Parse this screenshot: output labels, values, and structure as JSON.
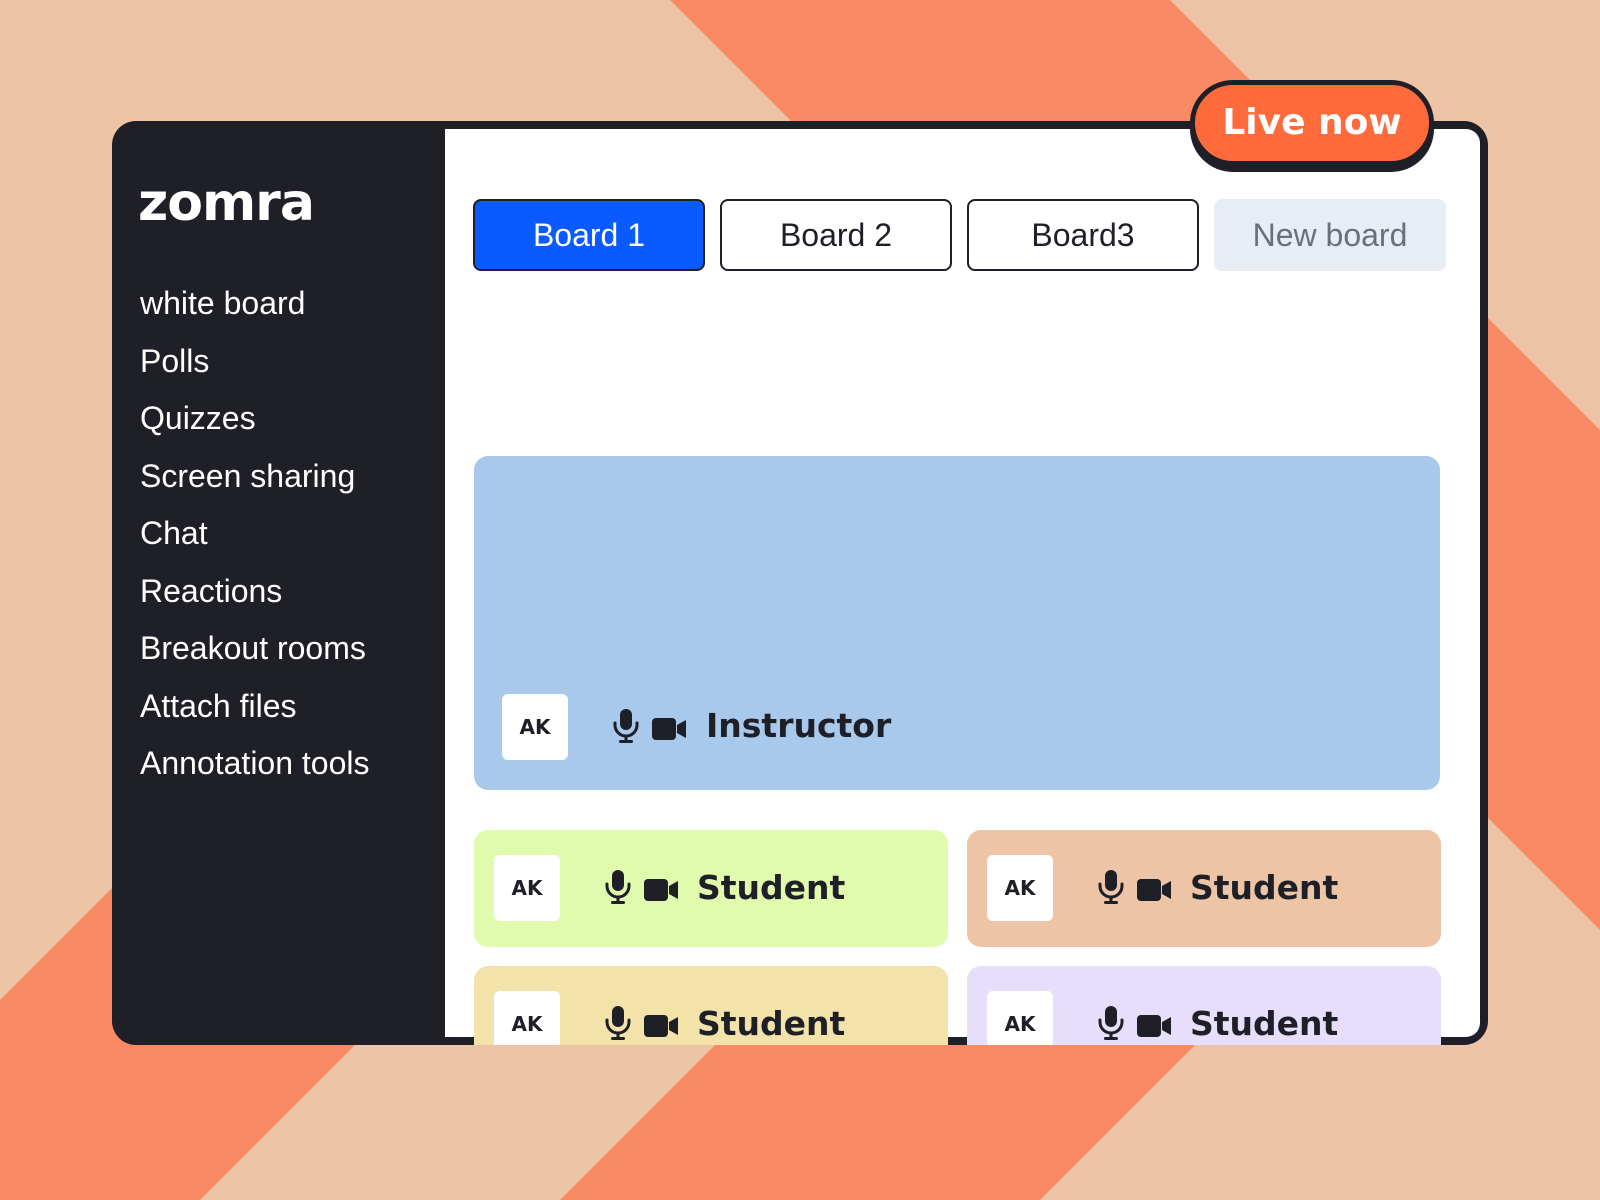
{
  "app": {
    "logo_text": "zomra"
  },
  "status": {
    "live_label": "Live now",
    "live_color": "#FF6A3D"
  },
  "sidebar": {
    "items": [
      {
        "label": "white board"
      },
      {
        "label": "Polls"
      },
      {
        "label": "Quizzes"
      },
      {
        "label": "Screen sharing"
      },
      {
        "label": "Chat"
      },
      {
        "label": "Reactions"
      },
      {
        "label": "Breakout rooms"
      },
      {
        "label": "Attach files"
      },
      {
        "label": "Annotation tools"
      }
    ]
  },
  "tabs": [
    {
      "label": "Board 1",
      "active": true
    },
    {
      "label": "Board 2",
      "active": false
    },
    {
      "label": "Board3",
      "active": false
    },
    {
      "label": "New board",
      "active": false
    }
  ],
  "participants": [
    {
      "initials": "AK",
      "role": "Instructor",
      "color": "#A8C8EC",
      "icons": [
        "microphone-icon",
        "video-camera-icon"
      ]
    },
    {
      "initials": "AK",
      "role": "Student",
      "color": "#E1FBAE",
      "icons": [
        "microphone-icon",
        "video-camera-icon"
      ]
    },
    {
      "initials": "AK",
      "role": "Student",
      "color": "#EDC4A5",
      "icons": [
        "microphone-icon",
        "video-camera-icon"
      ]
    },
    {
      "initials": "AK",
      "role": "Student",
      "color": "#F3E3AA",
      "icons": [
        "microphone-icon",
        "video-camera-icon"
      ]
    },
    {
      "initials": "AK",
      "role": "Student",
      "color": "#E7DEFB",
      "icons": [
        "microphone-icon",
        "video-camera-icon"
      ]
    }
  ],
  "colors": {
    "background": "#EDC4A5",
    "stripes": "#F98A63",
    "sidebar": "#1E1F27",
    "accent": "#0A5BFF"
  }
}
